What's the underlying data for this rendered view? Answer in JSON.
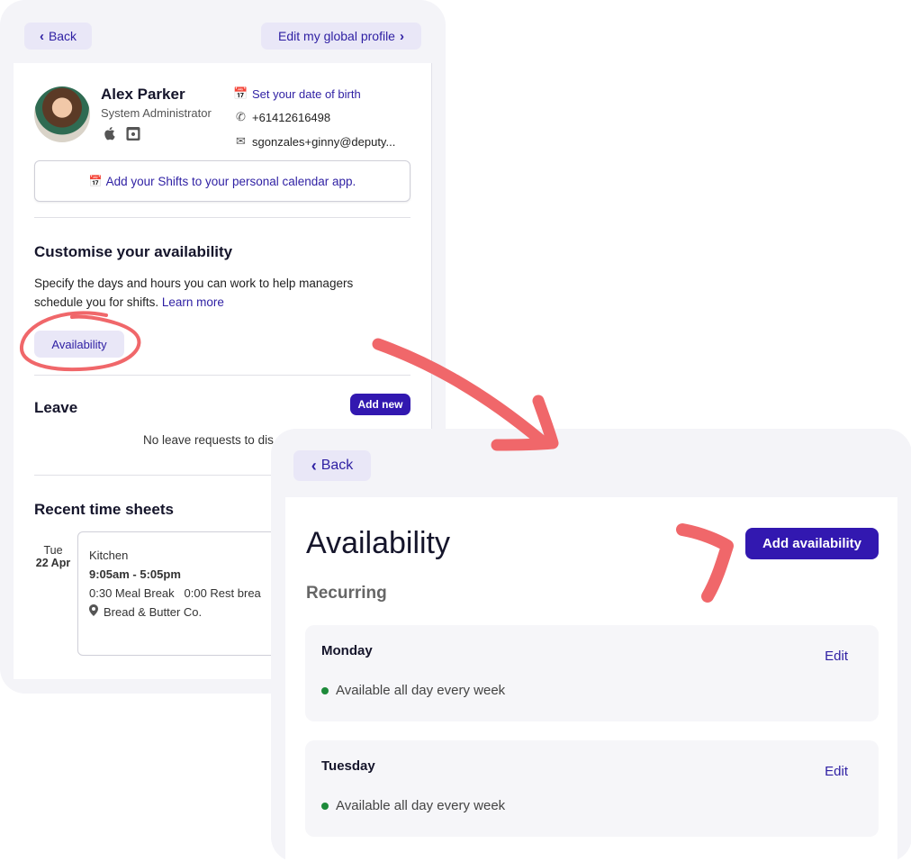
{
  "profile_panel": {
    "back_label": "Back",
    "edit_profile_label": "Edit my global profile",
    "user": {
      "name": "Alex Parker",
      "role": "System Administrator",
      "dob_link": "Set your date of birth",
      "phone": "+61412616498",
      "email": "sgonzales+ginny@deputy..."
    },
    "calendar_link": "Add your Shifts to your personal calendar app.",
    "availability_section": {
      "title": "Customise your availability",
      "description": "Specify the days and hours you can work to help managers schedule you for shifts.",
      "learn_more": "Learn more",
      "button_label": "Availability"
    },
    "leave_section": {
      "title": "Leave",
      "add_new_label": "Add new",
      "empty_text": "No leave requests to dis"
    },
    "timesheets_section": {
      "title": "Recent time sheets",
      "entry": {
        "day": "Tue",
        "date": "22 Apr",
        "area": "Kitchen",
        "hours": "9:05am - 5:05pm",
        "breaks": "0:30 Meal Break   0:00 Rest brea",
        "location": "Bread & Butter Co."
      }
    }
  },
  "availability_panel": {
    "back_label": "Back",
    "title": "Availability",
    "add_label": "Add availability",
    "recurring_label": "Recurring",
    "days": [
      {
        "name": "Monday",
        "edit_label": "Edit",
        "status": "Available all day every week"
      },
      {
        "name": "Tuesday",
        "edit_label": "Edit",
        "status": "Available all day every week"
      }
    ]
  },
  "colors": {
    "accent": "#3218b0",
    "link": "#2e1fa3",
    "annotation": "#f0676a",
    "available": "#1d8a3a"
  }
}
